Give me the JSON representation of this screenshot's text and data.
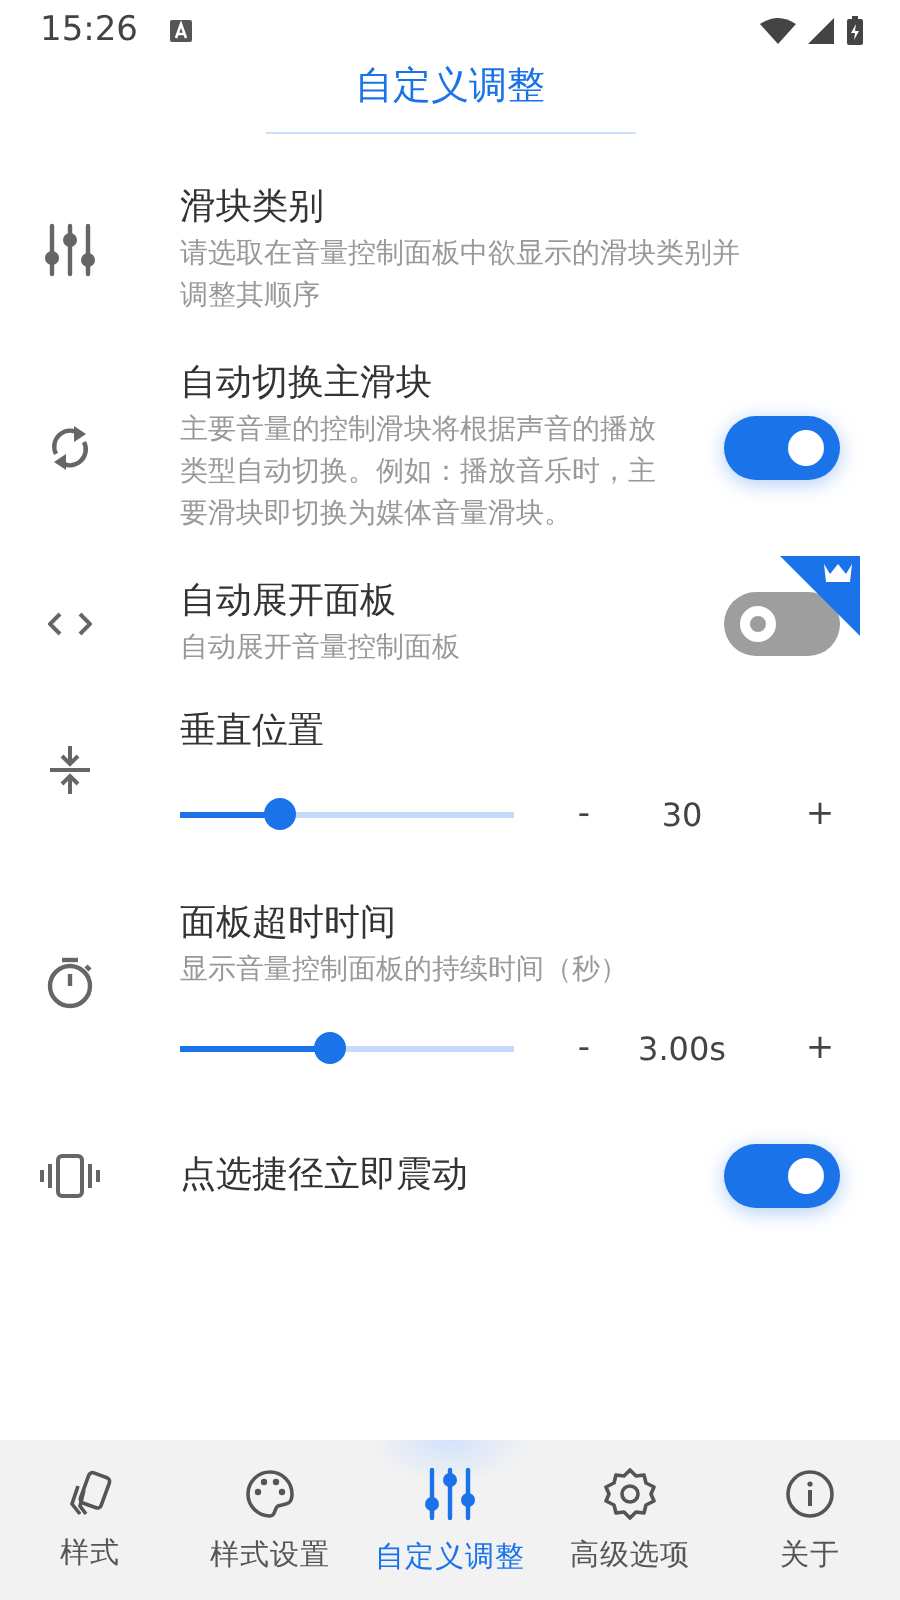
{
  "status_bar": {
    "time": "15:26"
  },
  "header": {
    "title": "自定义调整"
  },
  "settings": [
    {
      "kind": "nav",
      "title": "滑块类别",
      "description": "请选取在音量控制面板中欲显示的滑块类别并调整其顺序"
    },
    {
      "kind": "toggle",
      "title": "自动切换主滑块",
      "description": "主要音量的控制滑块将根据声音的播放类型自动切换。例如：播放音乐时，主要滑块即切换为媒体音量滑块。",
      "on": true,
      "premium": false
    },
    {
      "kind": "toggle",
      "title": "自动展开面板",
      "description": "自动展开音量控制面板",
      "on": false,
      "premium": true
    },
    {
      "kind": "slider",
      "title": "垂直位置",
      "level": 0.3,
      "minus": "-",
      "value": "30",
      "plus": "+"
    },
    {
      "kind": "slider",
      "title": "面板超时时间",
      "description": "显示音量控制面板的持续时间（秒）",
      "level": 0.45,
      "minus": "-",
      "value": "3.00s",
      "plus": "+"
    },
    {
      "kind": "toggle",
      "title": "点选捷径立即震动",
      "on": true,
      "premium": false
    }
  ],
  "bottom_nav": [
    {
      "label": "样式",
      "selected": false
    },
    {
      "label": "样式设置",
      "selected": false
    },
    {
      "label": "自定义调整",
      "selected": true
    },
    {
      "label": "高级选项",
      "selected": false
    },
    {
      "label": "关于",
      "selected": false
    }
  ]
}
